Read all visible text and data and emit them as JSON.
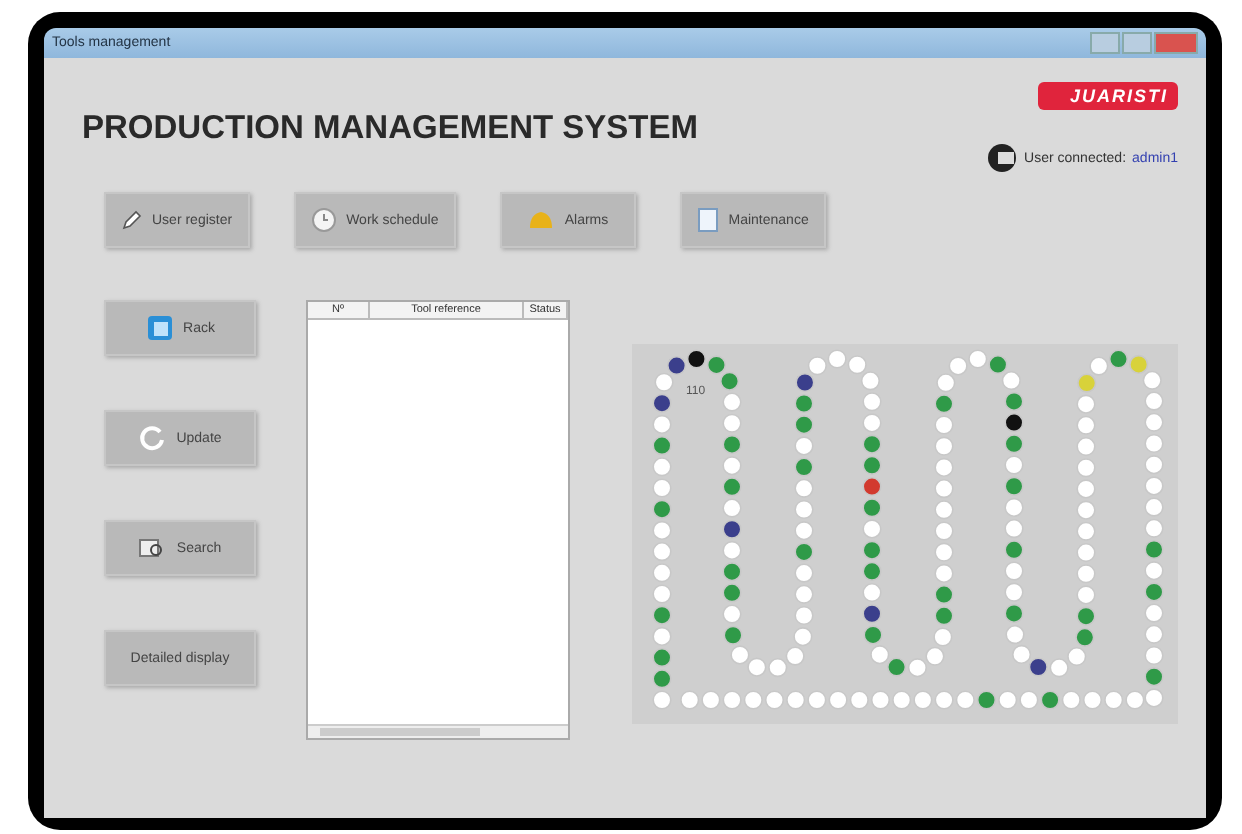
{
  "window": {
    "title": "Tools management"
  },
  "header": {
    "title": "PRODUCTION MANAGEMENT SYSTEM",
    "logo": "JUARISTI"
  },
  "user": {
    "label": "User connected:",
    "name": "admin1"
  },
  "toolbar": [
    {
      "label": "User register",
      "kind": "pencil"
    },
    {
      "label": "Work schedule",
      "kind": "clock"
    },
    {
      "label": "Alarms",
      "kind": "bell"
    },
    {
      "label": "Maintenance",
      "kind": "sheet"
    }
  ],
  "side_buttons": [
    {
      "label": "Rack",
      "kind": "rack"
    },
    {
      "label": "Update",
      "kind": "refresh"
    },
    {
      "label": "Search",
      "kind": "search"
    },
    {
      "label": "Detailed display",
      "kind": "none"
    }
  ],
  "table": {
    "columns": [
      "Nº",
      "Tool reference",
      "Status"
    ]
  },
  "magazine": {
    "label": "110"
  }
}
